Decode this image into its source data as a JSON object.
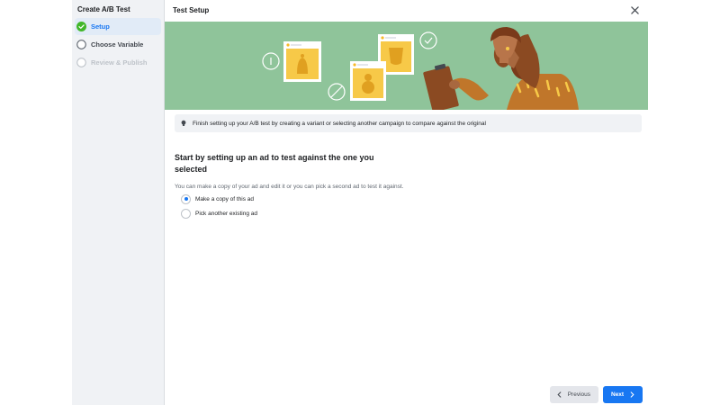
{
  "sidebar": {
    "title": "Create A/B Test",
    "steps": [
      {
        "label": "Setup",
        "state": "complete",
        "icon": "check-circle-icon"
      },
      {
        "label": "Choose Variable",
        "state": "pending",
        "icon": "empty-circle-icon"
      },
      {
        "label": "Review & Publish",
        "state": "disabled",
        "icon": "empty-circle-icon"
      }
    ]
  },
  "header": {
    "title": "Test Setup",
    "close_icon": "close-icon"
  },
  "banner": {
    "text": "Finish setting up your A/B test by creating a variant or selecting another campaign to compare against the original",
    "icon": "lightbulb-icon"
  },
  "main": {
    "heading": "Start by setting up an ad to test against the one you selected",
    "description": "You can make a copy of your ad and edit it or you can pick a second ad to test it against.",
    "options": [
      {
        "label": "Make a copy of this ad",
        "selected": true
      },
      {
        "label": "Pick another existing ad",
        "selected": false
      }
    ]
  },
  "footer": {
    "previous_label": "Previous",
    "next_label": "Next"
  },
  "colors": {
    "accent": "#1877f2",
    "hero_background": "#8fc49a",
    "success": "#42b72a",
    "sidebar_background": "#f0f2f5"
  }
}
